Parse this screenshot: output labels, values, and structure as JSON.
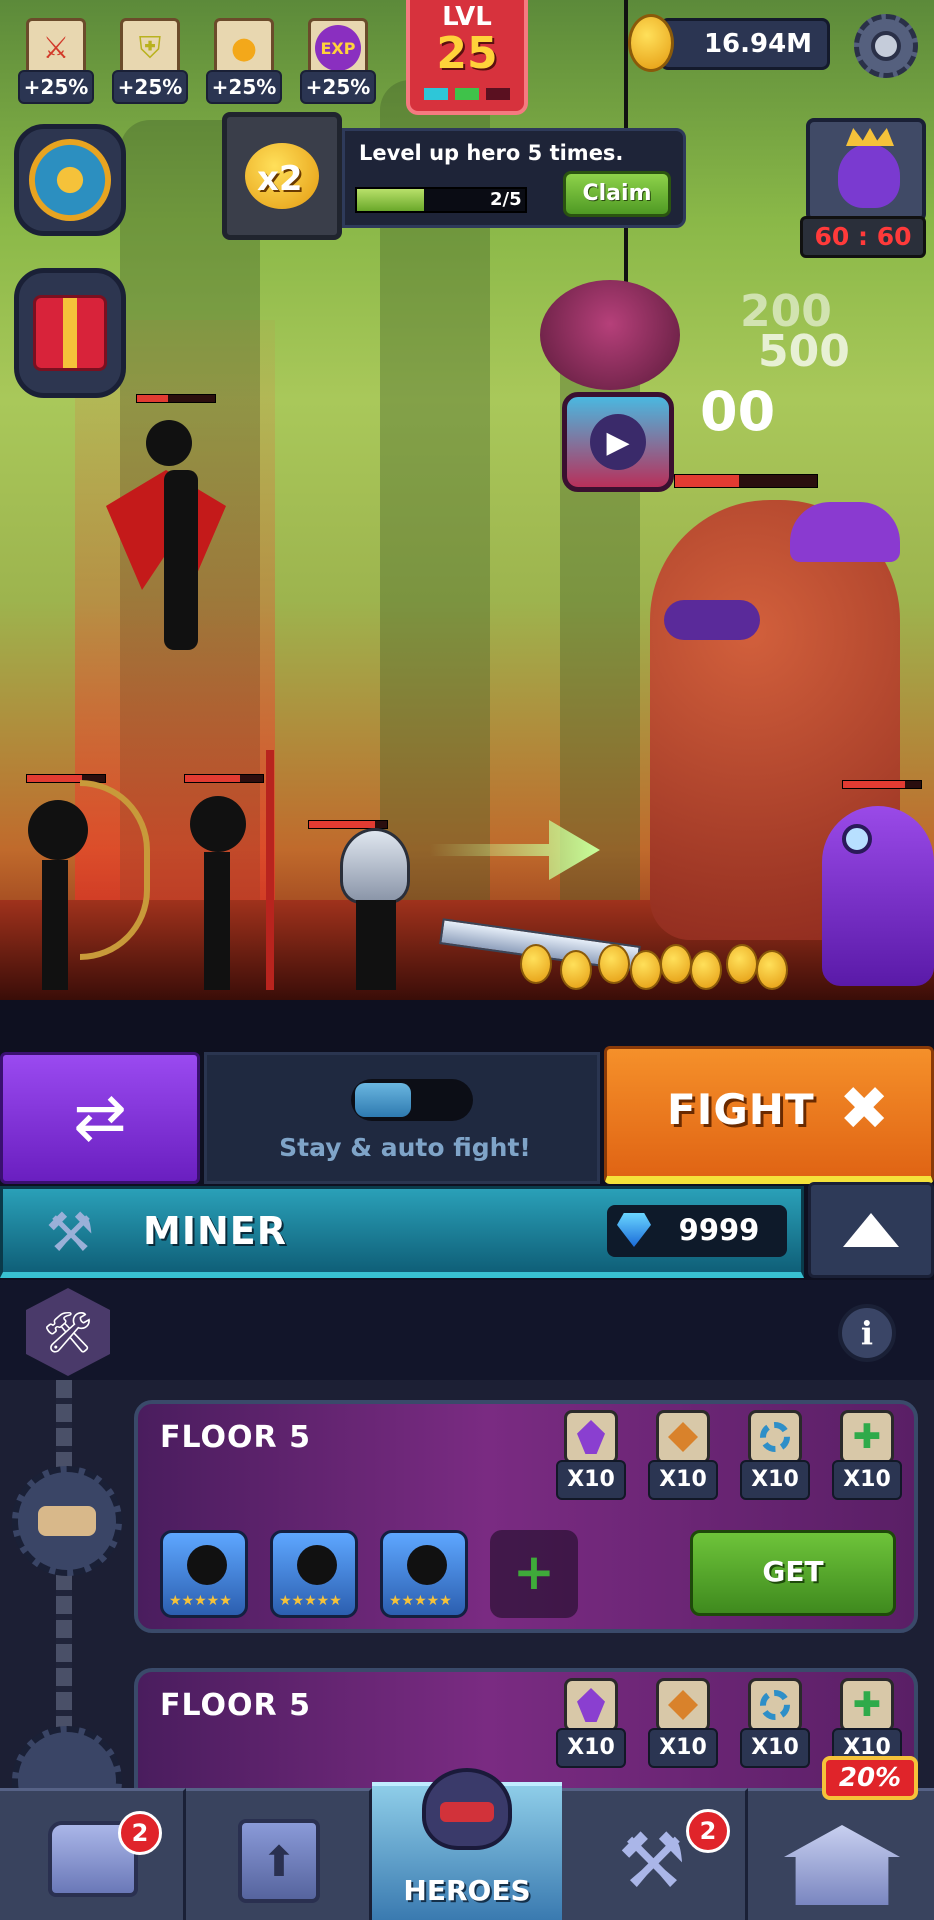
{
  "stats": [
    {
      "icon": "sword-icon",
      "glyph": "⚔",
      "label": "+25%"
    },
    {
      "icon": "shield-icon",
      "glyph": "⛨",
      "label": "+25%"
    },
    {
      "icon": "coin-icon",
      "glyph": "●",
      "label": "+25%"
    },
    {
      "icon": "exp-icon",
      "glyph": "EXP",
      "label": "+25%"
    }
  ],
  "level": {
    "label": "LVL",
    "value": "25"
  },
  "currency": {
    "gold": "16.94M"
  },
  "quest": {
    "badge": "x2",
    "text": "Level up hero 5 times.",
    "progress": "2/5",
    "progress_fraction": 0.4,
    "claim_label": "Claim"
  },
  "boss_timer": "60 : 60",
  "damage_numbers": [
    "200",
    "500",
    "00"
  ],
  "controls": {
    "auto_fight_label": "Stay & auto fight!",
    "fight_label": "FIGHT"
  },
  "miner": {
    "title": "MINER",
    "gems": "9999"
  },
  "floors": [
    {
      "title": "FLOOR 5",
      "resources": [
        {
          "icon": "purple-crystal-icon",
          "color": "#8a3fd0",
          "amount": "X10"
        },
        {
          "icon": "orange-crystal-icon",
          "color": "#d9822b",
          "amount": "X10"
        },
        {
          "icon": "blue-gear-icon",
          "color": "#2e8fc8",
          "amount": "X10"
        },
        {
          "icon": "green-plus-icon",
          "color": "#2faa4a",
          "amount": "X10"
        }
      ],
      "heroes": 3,
      "get_label": "GET"
    },
    {
      "title": "FLOOR 5",
      "resources": [
        {
          "icon": "purple-crystal-icon",
          "color": "#8a3fd0",
          "amount": "X10"
        },
        {
          "icon": "orange-crystal-icon",
          "color": "#d9822b",
          "amount": "X10"
        },
        {
          "icon": "blue-gear-icon",
          "color": "#2e8fc8",
          "amount": "X10"
        },
        {
          "icon": "green-plus-icon",
          "color": "#2faa4a",
          "amount": "X10"
        }
      ]
    }
  ],
  "nav": {
    "chest_badge": "2",
    "heroes_label": "HEROES",
    "mine_badge": "2",
    "shop_discount": "20%"
  },
  "colors": {
    "fight": "#f07a1c",
    "swap": "#7a2fd0",
    "miner_bar": "#1c7f95",
    "get": "#4ea829"
  }
}
